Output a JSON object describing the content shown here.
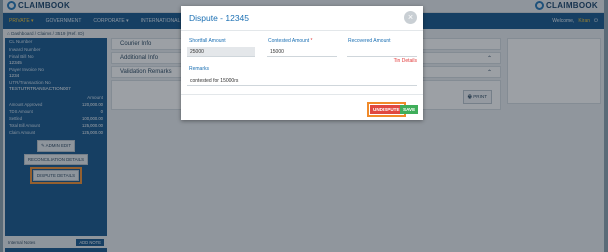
{
  "header": {
    "logo_left": "CLAIMBOOK",
    "logo_right": "CLAIMBOOK"
  },
  "nav": {
    "items": [
      "PRIVATE ▾",
      "GOVERNMENT",
      "CORPORATE ▾",
      "INTERNATIONAL"
    ],
    "welcome": "Welcome,",
    "user": "Kiran",
    "power_icon": "power-icon"
  },
  "breadcrumb": {
    "text": "Dashboard / Claims / 3519 (Ref. ID)"
  },
  "sidebar": {
    "rows": [
      {
        "label": "CL Number",
        "value": ""
      },
      {
        "label": "Inward Number",
        "value": ""
      },
      {
        "label": "Final Bill No",
        "value": "12345"
      },
      {
        "label": "Payer Invoice No",
        "value": "1234"
      },
      {
        "label": "UTR/Transaction No",
        "value": "TESTUTRTRANSACTION007"
      }
    ],
    "amount_header": "Amount",
    "amounts": [
      {
        "label": "Amount Approved",
        "value": "120,000.00"
      },
      {
        "label": "TDS Amount",
        "value": "0"
      },
      {
        "label": "Settled",
        "value": "100,000.00"
      },
      {
        "label": "Total Bill Amount",
        "value": "125,000.00"
      },
      {
        "label": "Claim Amount",
        "value": "125,000.00"
      }
    ],
    "admin_edit": "✎ ADMIN EDIT",
    "reconciliation": "RECONCILIATION DETAILS",
    "dispute": "DISPUTE DETAILS"
  },
  "internal": {
    "label": "Internal Notes",
    "add_note": "ADD NOTE"
  },
  "main": {
    "panels": [
      "Courier Info",
      "Additional Info",
      "Validation Remarks"
    ],
    "print": "PRINT"
  },
  "modal": {
    "title": "Dispute - 12345",
    "shortfall_label": "Shortfall Amount",
    "shortfall_value": "25000",
    "contested_label": "Contested Amount",
    "contested_req": "*",
    "contested_value": "15000",
    "recovered_label": "Recovered Amount",
    "recovered_value": "",
    "tin_details": "Tin Details",
    "remarks_label": "Remarks",
    "remarks_value": "contested for 15000rs",
    "undispute": "UNDISPUTE",
    "save": "SAVE"
  }
}
